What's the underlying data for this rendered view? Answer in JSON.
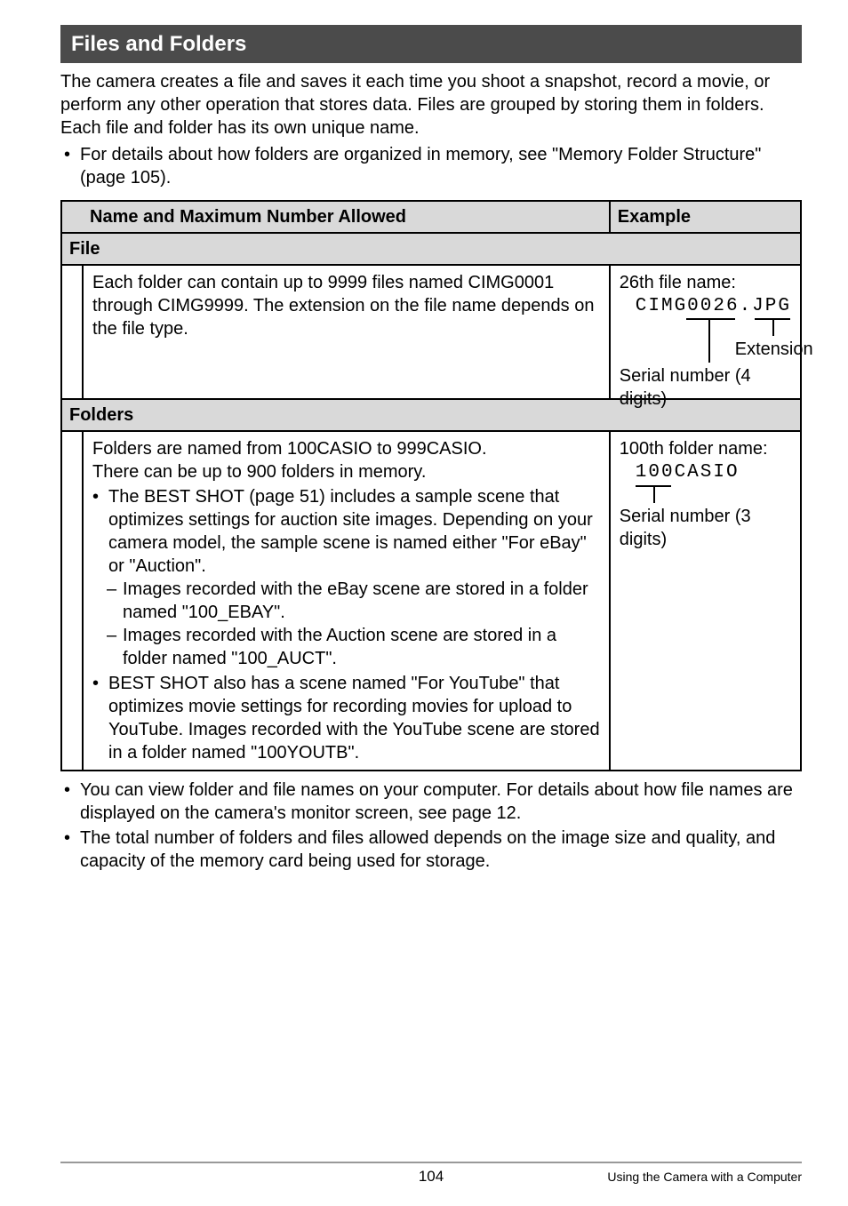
{
  "header": {
    "title": "Files and Folders"
  },
  "intro": {
    "p1": "The camera creates a file and saves it each time you shoot a snapshot, record a movie, or perform any other operation that stores data. Files are grouped by storing them in folders. Each file and folder has its own unique name.",
    "b1": "For details about how folders are organized in memory, see \"Memory Folder Structure\" (page 105)."
  },
  "table": {
    "col1": "Name and Maximum Number Allowed",
    "col2": "Example",
    "file_hdr": "File",
    "file_desc": "Each folder can contain up to 9999 files named CIMG0001 through CIMG9999. The extension on the file name depends on the file type.",
    "file_ex_title": "26th file name:",
    "file_ex_name": "CIMG0026.JPG",
    "file_ex_ext": "Extension",
    "file_ex_serial": "Serial number (4 digits)",
    "folders_hdr": "Folders",
    "fold_p1": "Folders are named from 100CASIO to 999CASIO.",
    "fold_p2": "There can be up to 900 folders in memory.",
    "fold_b1": "The BEST SHOT (page 51) includes a sample scene that optimizes settings for auction site images. Depending on your camera model, the sample scene is named either \"For eBay\" or \"Auction\".",
    "fold_d1": "Images recorded with the eBay scene are stored in a folder named \"100_EBAY\".",
    "fold_d2": "Images recorded with the Auction scene are stored in a folder named \"100_AUCT\".",
    "fold_b2": "BEST SHOT also has a scene named \"For YouTube\" that optimizes movie settings for recording movies for upload to YouTube. Images recorded with the YouTube scene are stored in a folder named \"100YOUTB\".",
    "fold_ex_title": "100th folder name:",
    "fold_ex_name": "100CASIO",
    "fold_ex_serial": "Serial number (3 digits)"
  },
  "after": {
    "b1": "You can view folder and file names on your computer. For details about how file names are displayed on the camera's monitor screen, see page 12.",
    "b2": "The total number of folders and files allowed depends on the image size and quality, and capacity of the memory card being used for storage."
  },
  "footer": {
    "page": "104",
    "section": "Using the Camera with a Computer"
  }
}
